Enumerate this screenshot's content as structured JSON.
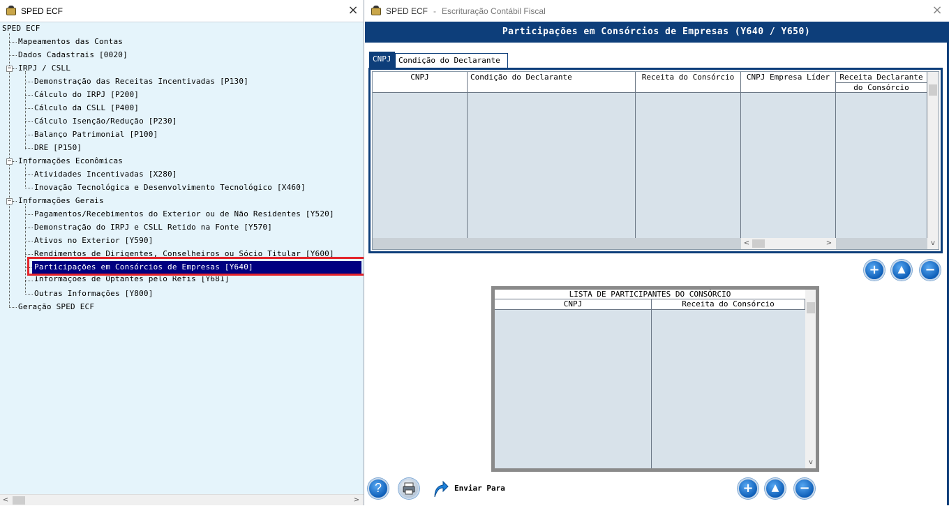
{
  "left_window": {
    "title": "SPED ECF",
    "tree": {
      "root": "SPED ECF",
      "items": [
        {
          "label": "Mapeamentos das Contas"
        },
        {
          "label": "Dados Cadastrais [0020]"
        },
        {
          "label": "IRPJ / CSLL"
        },
        {
          "label": "Demonstração das Receitas Incentivadas [P130]"
        },
        {
          "label": "Cálculo do IRPJ [P200]"
        },
        {
          "label": "Cálculo da CSLL [P400]"
        },
        {
          "label": "Cálculo Isenção/Redução [P230]"
        },
        {
          "label": "Balanço Patrimonial [P100]"
        },
        {
          "label": "DRE [P150]"
        },
        {
          "label": "Informações Econômicas"
        },
        {
          "label": "Atividades Incentivadas [X280]"
        },
        {
          "label": "Inovação Tecnológica e Desenvolvimento Tecnológico [X460]"
        },
        {
          "label": "Informações Gerais"
        },
        {
          "label": "Pagamentos/Recebimentos do Exterior ou de Não Residentes [Y520]"
        },
        {
          "label": "Demonstração do IRPJ e CSLL Retido na Fonte [Y570]"
        },
        {
          "label": "Ativos no Exterior [Y590]"
        },
        {
          "label": "Rendimentos de Dirigentes, Conselheiros ou Sócio Titular [Y600]"
        },
        {
          "label": "Participações em Consórcios de Empresas [Y640]"
        },
        {
          "label": "Informações de Optantes pelo Refis [Y681]"
        },
        {
          "label": "Outras Informações [Y800]"
        },
        {
          "label": "Geração SPED ECF"
        }
      ]
    }
  },
  "right_window": {
    "app_name": "SPED ECF",
    "title_sep": "-",
    "subtitle": "Escrituração Contábil Fiscal",
    "header": "Participações em Consórcios de Empresas (Y640 / Y650)",
    "tabs": [
      {
        "label": "CNPJ"
      },
      {
        "label": "Condição do Declarante"
      }
    ],
    "grid": {
      "columns": [
        "CNPJ",
        "Condição do Declarante",
        "Receita do Consórcio",
        "CNPJ Empresa Líder",
        "Receita Declarante",
        "do Consórcio"
      ]
    },
    "list": {
      "title": "LISTA DE PARTICIPANTES DO CONSÓRCIO",
      "columns": [
        "CNPJ",
        "Receita do Consórcio"
      ]
    },
    "send_label": "Enviar Para"
  },
  "colors": {
    "accent": "#0d3e7a",
    "selection": "#000080",
    "highlight_border": "#e3242b",
    "tree_bg": "#e5f4fb",
    "grid_bg": "#d8e2ea"
  }
}
